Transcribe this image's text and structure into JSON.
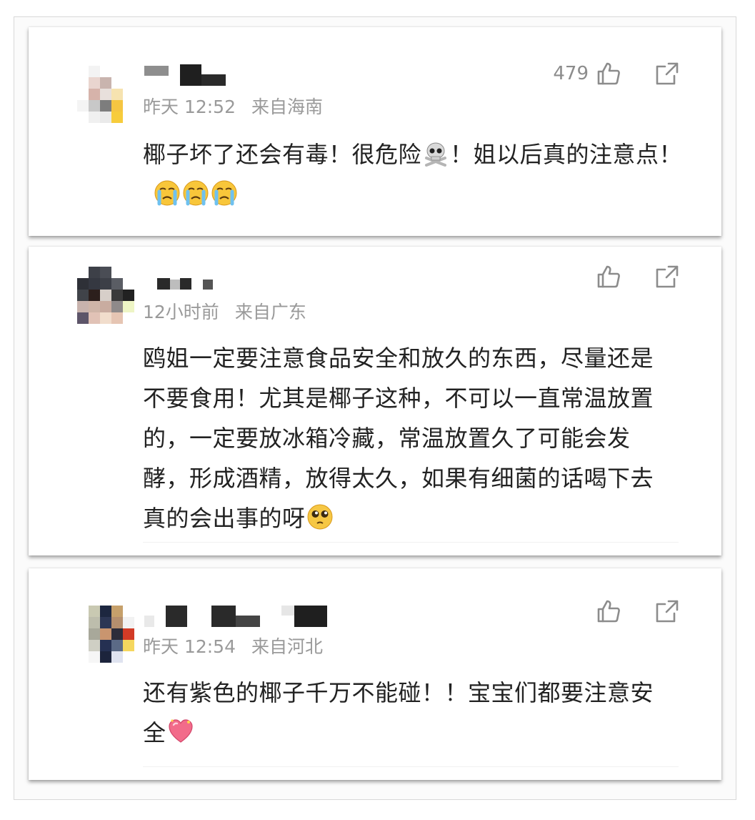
{
  "comments": [
    {
      "time": "昨天 12:52",
      "location": "来自海南",
      "likes": "479",
      "text_part1": "椰子坏了还会有毒！很危险",
      "text_part2": "！姐以后真的注意点！",
      "emojis": [
        "skull-crossbones-emoji",
        "crying-face-emoji",
        "crying-face-emoji",
        "crying-face-emoji"
      ]
    },
    {
      "time": "12小时前",
      "location": "来自广东",
      "likes": "",
      "text_part1": "鸥姐一定要注意食品安全和放久的东西，尽量还是不要食用！尤其是椰子这种，不可以一直常温放置的，一定要放冰箱冷藏，常温放置久了可能会发酵，形成酒精，放得太久，如果有细菌的话喝下去真的会出事的呀",
      "emojis": [
        "pleading-face-emoji"
      ]
    },
    {
      "time": "昨天 12:54",
      "location": "来自河北",
      "likes": "",
      "text_part1": "还有紫色的椰子千万不能碰！！宝宝们都要注意安全",
      "emojis": [
        "heart-emoji"
      ]
    }
  ],
  "icons": {
    "like": "thumbs-up-icon",
    "share": "share-icon"
  },
  "colors": {
    "meta_text": "#9a9a9a",
    "body_text": "#222222",
    "icon": "#8c8c8c"
  }
}
